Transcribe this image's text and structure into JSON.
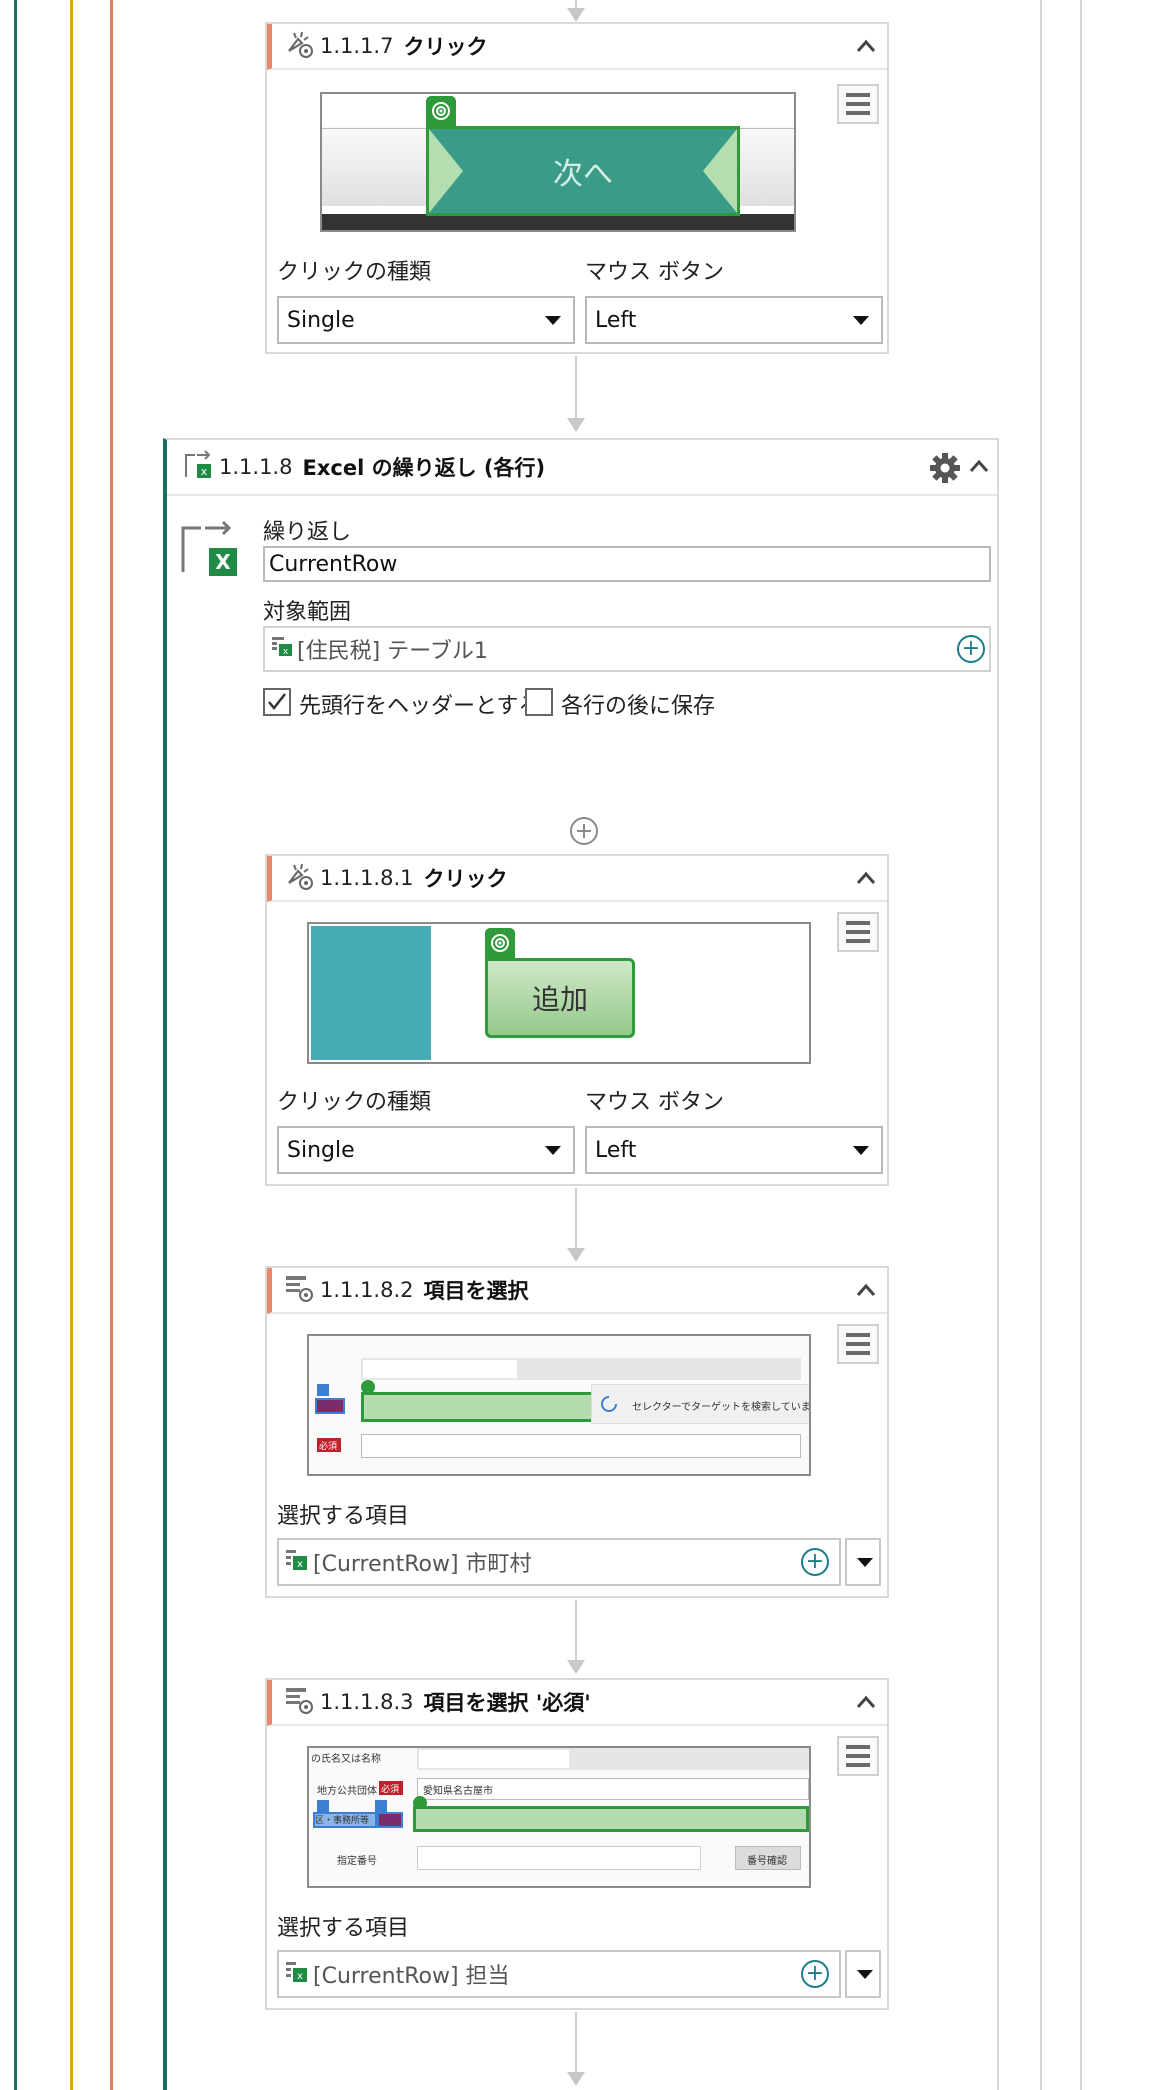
{
  "colors": {
    "line_teal": "#1a6e64",
    "line_gold": "#e0a020",
    "line_coral": "#e08060",
    "card_accent": "#e88a6a",
    "loop_accent": "#1a6e64"
  },
  "click_117": {
    "number": "1.1.1.7",
    "title": "クリック",
    "preview_button_text": "次へ",
    "click_type_label": "クリックの種類",
    "click_type_value": "Single",
    "mouse_button_label": "マウス ボタン",
    "mouse_button_value": "Left"
  },
  "loop_118": {
    "number": "1.1.1.8",
    "title": "Excel の繰り返し (各行)",
    "repeat_label": "繰り返し",
    "repeat_value": "CurrentRow",
    "range_label": "対象範囲",
    "range_value": "[住民税] テーブル1",
    "header_checkbox_label": "先頭行をヘッダーとする",
    "header_checked": true,
    "save_checkbox_label": "各行の後に保存",
    "save_checked": false
  },
  "click_1181": {
    "number": "1.1.1.8.1",
    "title": "クリック",
    "preview_button_text": "追加",
    "click_type_label": "クリックの種類",
    "click_type_value": "Single",
    "mouse_button_label": "マウス ボタン",
    "mouse_button_value": "Left"
  },
  "select_1182": {
    "number": "1.1.1.8.2",
    "title": "項目を選択",
    "preview_required": "必須",
    "preview_status": "セレクターでターゲットを検索しています。",
    "item_label": "選択する項目",
    "item_value": "[CurrentRow] 市町村"
  },
  "select_1183": {
    "number": "1.1.1.8.3",
    "title": "項目を選択 '必須'",
    "preview_row1": "の氏名又は名称",
    "preview_row2_label": "地方公共団体",
    "preview_required": "必須",
    "preview_row2_value": "愛知県名古屋市",
    "preview_row3_label": "区・事務所等",
    "preview_row4_label": "指定番号",
    "preview_button": "番号確認",
    "item_label": "選択する項目",
    "item_value": "[CurrentRow] 担当"
  }
}
